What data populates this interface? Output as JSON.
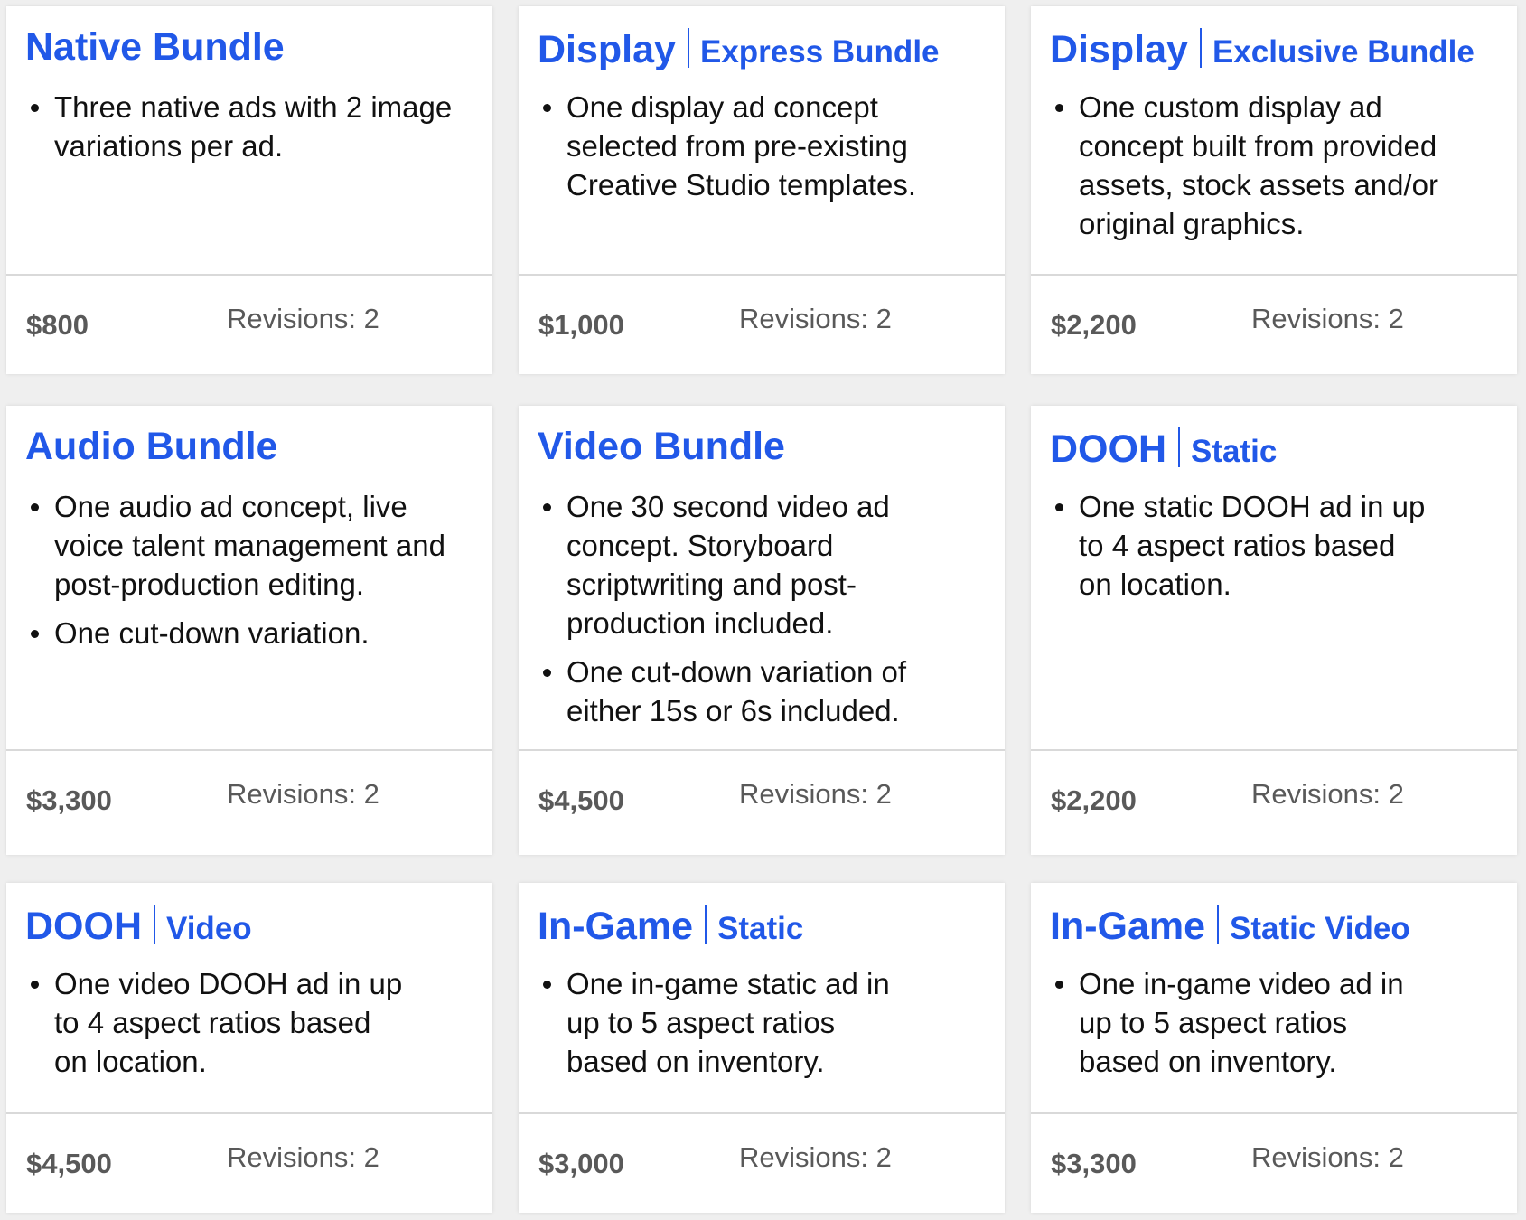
{
  "colors": {
    "accent": "#2158e8",
    "text": "#111111",
    "muted": "#595959",
    "background": "#efefef",
    "card": "#ffffff"
  },
  "bundles": [
    {
      "title": "Native Bundle",
      "subtitle": "",
      "bullets": [
        "Three native ads with 2  image variations per ad."
      ],
      "price": "$800",
      "revisions": "Revisions: 2"
    },
    {
      "title": "Display",
      "subtitle": "Express Bundle",
      "bullets": [
        "One display ad concept selected from pre-existing Creative Studio templates."
      ],
      "price": "$1,000",
      "revisions": "Revisions: 2"
    },
    {
      "title": "Display",
      "subtitle": "Exclusive Bundle",
      "bullets": [
        "One custom display ad concept built from provided assets, stock assets and/or original graphics."
      ],
      "price": "$2,200",
      "revisions": "Revisions: 2"
    },
    {
      "title": "Audio Bundle",
      "subtitle": "",
      "bullets": [
        "One audio ad concept, live voice talent management and post-production editing.",
        "One cut-down variation."
      ],
      "price": "$3,300",
      "revisions": "Revisions: 2"
    },
    {
      "title": "Video Bundle",
      "subtitle": "",
      "bullets": [
        "One 30 second video ad concept. Storyboard scriptwriting and post-production included.",
        "One cut-down variation of either 15s or 6s included."
      ],
      "price": "$4,500",
      "revisions": "Revisions: 2"
    },
    {
      "title": "DOOH",
      "subtitle": "Static",
      "bullets": [
        "One static DOOH ad in up to 4 aspect ratios based on location."
      ],
      "price": "$2,200",
      "revisions": "Revisions: 2"
    },
    {
      "title": "DOOH",
      "subtitle": "Video",
      "bullets": [
        "One video DOOH ad in up to 4 aspect ratios based on location."
      ],
      "price": "$4,500",
      "revisions": "Revisions: 2"
    },
    {
      "title": "In-Game",
      "subtitle": "Static",
      "bullets": [
        "One in-game static ad in up to 5 aspect ratios based on inventory."
      ],
      "price": "$3,000",
      "revisions": "Revisions: 2"
    },
    {
      "title": "In-Game",
      "subtitle": "Static Video",
      "bullets": [
        "One in-game video ad in up to 5 aspect ratios based on inventory."
      ],
      "price": "$3,300",
      "revisions": "Revisions: 2"
    }
  ]
}
